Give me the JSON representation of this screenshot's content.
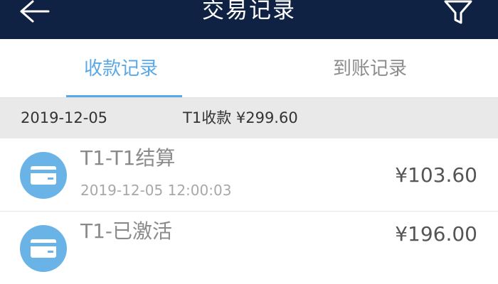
{
  "header": {
    "title": "交易记录",
    "back_icon": "back-arrow-icon",
    "filter_icon": "filter-icon"
  },
  "tabs": [
    {
      "label": "收款记录",
      "active": true
    },
    {
      "label": "到账记录",
      "active": false
    }
  ],
  "summary": {
    "date": "2019-12-05",
    "total": "T1收款 ¥299.60"
  },
  "records": [
    {
      "title": "T1-T1结算",
      "time": "2019-12-05 12:00:03",
      "amount": "¥103.60",
      "icon": "bank-card-icon"
    },
    {
      "title": "T1-已激活",
      "time": "",
      "amount": "¥196.00",
      "icon": "bank-card-icon"
    }
  ],
  "colors": {
    "header_bg": "#0f2244",
    "accent": "#5aa9e6",
    "icon_bg": "#69b3e7",
    "summary_bg": "#e9e9e9"
  }
}
